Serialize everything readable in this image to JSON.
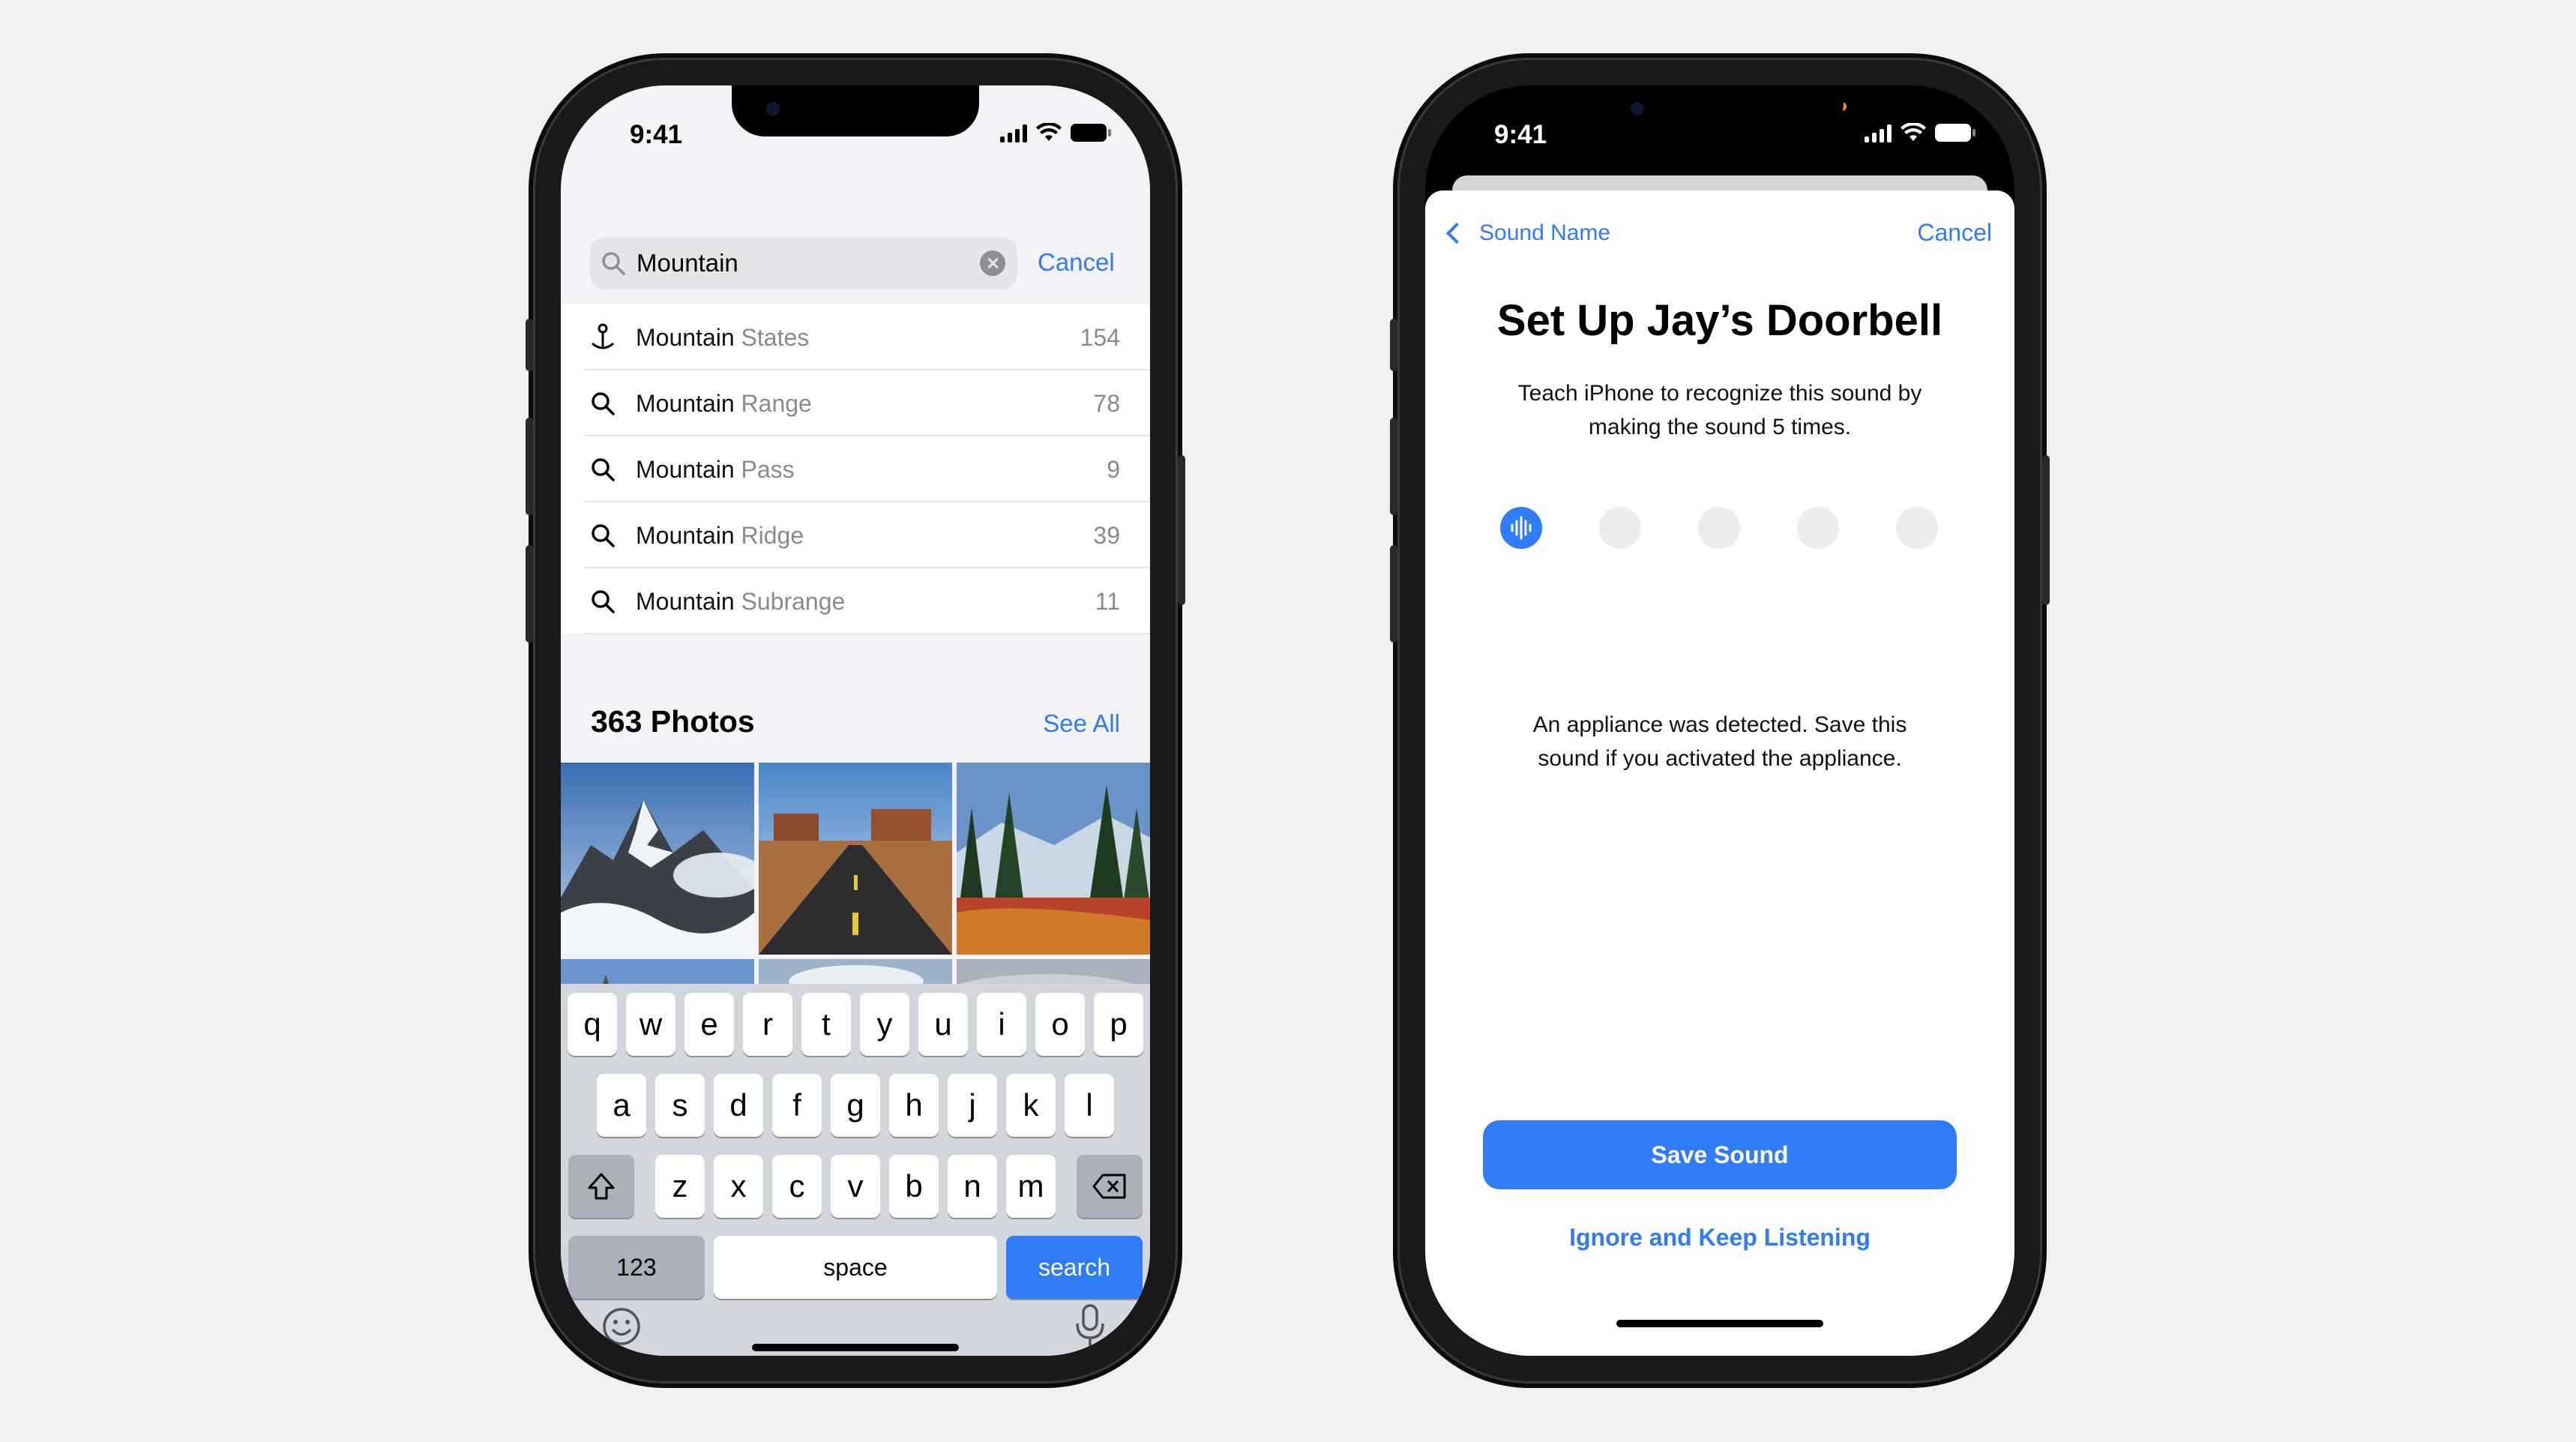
{
  "left_phone": {
    "status": {
      "time": "9:41"
    },
    "search": {
      "query": "Mountain",
      "cancel": "Cancel"
    },
    "suggestions": [
      {
        "prefix": "Mountain",
        "rest": " States",
        "count": "154",
        "icon": "map-pin-icon"
      },
      {
        "prefix": "Mountain",
        "rest": " Range",
        "count": "78",
        "icon": "search-icon"
      },
      {
        "prefix": "Mountain",
        "rest": " Pass",
        "count": "9",
        "icon": "search-icon"
      },
      {
        "prefix": "Mountain",
        "rest": " Ridge",
        "count": "39",
        "icon": "search-icon"
      },
      {
        "prefix": "Mountain",
        "rest": " Subrange",
        "count": "11",
        "icon": "search-icon"
      }
    ],
    "photos": {
      "title": "363 Photos",
      "see_all": "See All"
    },
    "keyboard": {
      "row1": [
        "q",
        "w",
        "e",
        "r",
        "t",
        "y",
        "u",
        "i",
        "o",
        "p"
      ],
      "row2": [
        "a",
        "s",
        "d",
        "f",
        "g",
        "h",
        "j",
        "k",
        "l"
      ],
      "row3": [
        "z",
        "x",
        "c",
        "v",
        "b",
        "n",
        "m"
      ],
      "numbers": "123",
      "space": "space",
      "search": "search"
    }
  },
  "right_phone": {
    "status": {
      "time": "9:41"
    },
    "nav": {
      "back": "Sound Name",
      "cancel": "Cancel"
    },
    "title": "Set Up Jay’s Doorbell",
    "subtitle": "Teach iPhone to recognize this sound by making the sound 5 times.",
    "progress": {
      "completed": 1,
      "total": 5
    },
    "detected": "An appliance was detected. Save this sound if you activated the appliance.",
    "save_button": "Save Sound",
    "ignore_button": "Ignore and Keep Listening"
  },
  "colors": {
    "accent": "#2f7cf6",
    "background": "#eff0ef"
  }
}
